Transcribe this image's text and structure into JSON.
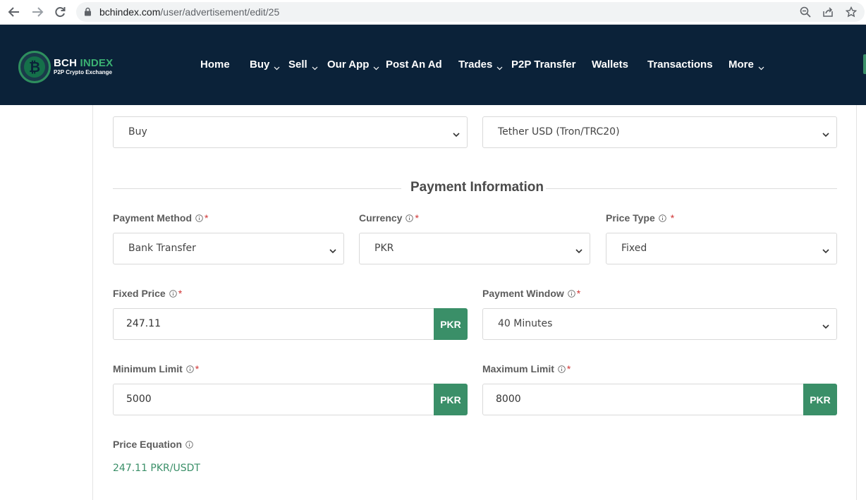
{
  "browser": {
    "url_host": "bchindex.com",
    "url_path": "/user/advertisement/edit/25"
  },
  "header": {
    "logo": {
      "title_main": "BCH",
      "title_accent": "INDEX",
      "subtitle": "P2P Crypto Exchange",
      "icon": "bitcoin-logo-icon"
    },
    "nav": [
      {
        "label": "Home",
        "dropdown": false
      },
      {
        "label": "Buy",
        "dropdown": true
      },
      {
        "label": "Sell",
        "dropdown": true
      },
      {
        "label": "Our App",
        "dropdown": true
      },
      {
        "label": "Post An Ad",
        "dropdown": false
      },
      {
        "label": "Trades",
        "dropdown": true
      },
      {
        "label": "P2P Transfer",
        "dropdown": false
      },
      {
        "label": "Wallets",
        "dropdown": false
      },
      {
        "label": "Transactions",
        "dropdown": false
      },
      {
        "label": "More",
        "dropdown": true
      }
    ]
  },
  "form": {
    "ad_type": "Buy",
    "crypto": "Tether USD (Tron/TRC20)",
    "payment_section_title": "Payment Information",
    "payment_method": {
      "label": "Payment Method",
      "value": "Bank Transfer"
    },
    "currency": {
      "label": "Currency",
      "value": "PKR"
    },
    "price_type": {
      "label": "Price Type",
      "value": "Fixed"
    },
    "fixed_price": {
      "label": "Fixed Price",
      "value": "247.11",
      "addon": "PKR"
    },
    "payment_window": {
      "label": "Payment Window",
      "value": "40 Minutes"
    },
    "minimum_limit": {
      "label": "Minimum Limit",
      "value": "5000",
      "addon": "PKR"
    },
    "maximum_limit": {
      "label": "Maximum Limit",
      "value": "8000",
      "addon": "PKR"
    },
    "price_equation": {
      "label": "Price Equation",
      "value": "247.11 PKR/USDT"
    },
    "required_mark": "*"
  },
  "colors": {
    "header_bg": "#0b2239",
    "accent_green": "#3a8f68",
    "required_red": "#d03333"
  }
}
